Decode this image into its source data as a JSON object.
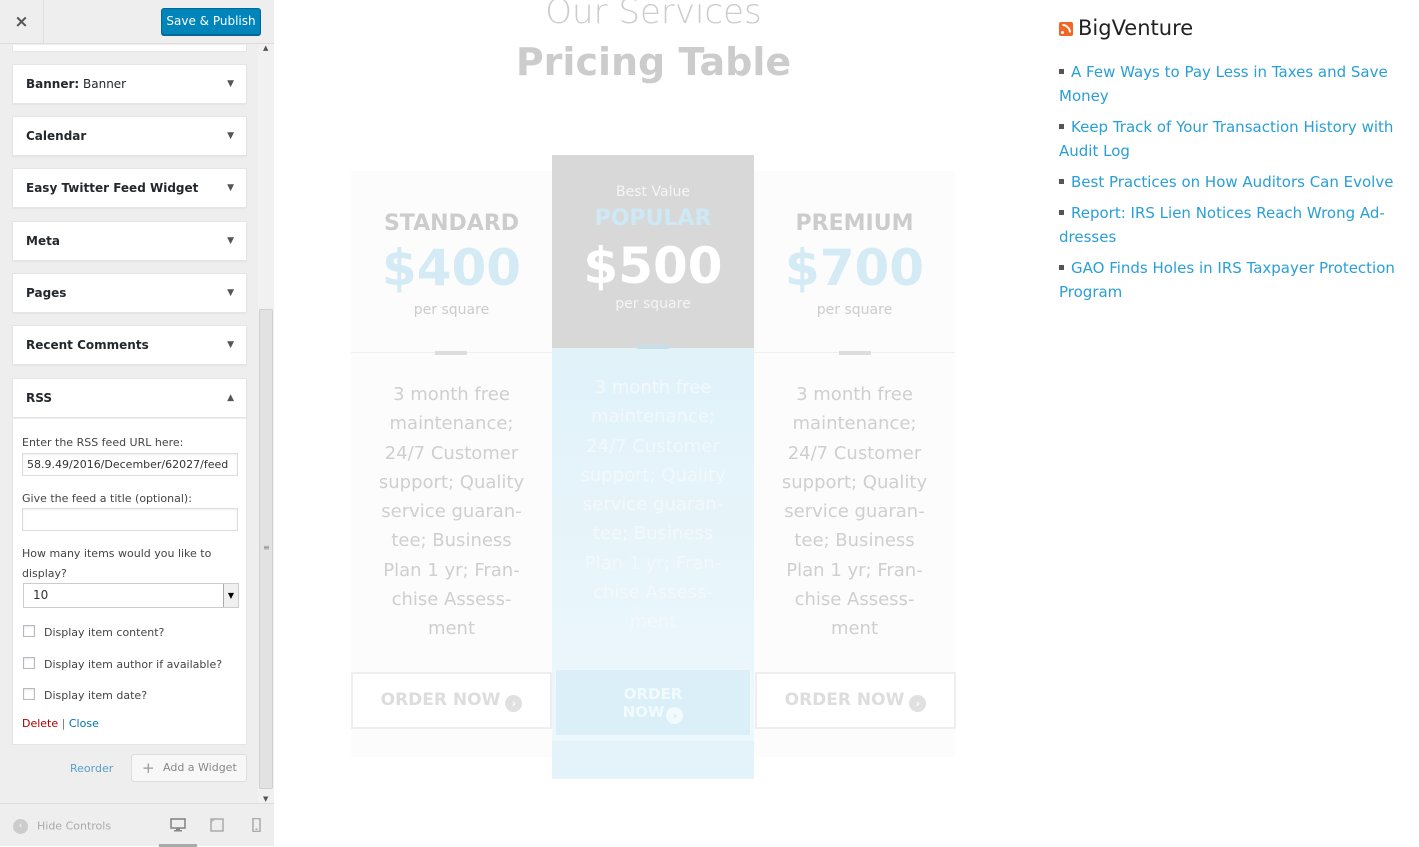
{
  "customizer": {
    "close_icon": "×",
    "publish_label": "Save & Publish",
    "widgets": [
      {
        "title": "Banner:",
        "subtitle": " Banner",
        "arrow": "▼"
      },
      {
        "title": "Calendar",
        "subtitle": "",
        "arrow": "▼"
      },
      {
        "title": "Easy Twitter Feed Widget",
        "subtitle": "",
        "arrow": "▼"
      },
      {
        "title": "Meta",
        "subtitle": "",
        "arrow": "▼"
      },
      {
        "title": "Pages",
        "subtitle": "",
        "arrow": "▼"
      },
      {
        "title": "Recent Comments",
        "subtitle": "",
        "arrow": "▼"
      },
      {
        "title": "RSS",
        "subtitle": "",
        "arrow": "▲"
      }
    ],
    "rss_form": {
      "url_label": "Enter the RSS feed URL here:",
      "url_value": "58.9.49/2016/December/62027/feed",
      "title_label": "Give the feed a title (optional):",
      "title_value": "",
      "items_label_line1": "How many items would you like to",
      "items_label_line2": "display?",
      "items_value": "10",
      "show_content_label": "Display item content?",
      "show_author_label": "Display item author if available?",
      "show_date_label": "Display item date?",
      "delete_label": "Delete",
      "separator": "|",
      "close_label": "Close"
    },
    "reorder_label": "Reorder",
    "add_widget_label": "Add a Widget",
    "hide_controls_label": "Hide Controls",
    "icons": {
      "add": "+",
      "scroll_up": "▲",
      "scroll_down": "▼",
      "scroll_grip": "≡",
      "hide_controls": "‹"
    }
  },
  "preview": {
    "section_title": "Our Services",
    "section_subtitle": "Pricing Table",
    "plans": {
      "standard": {
        "name": "STANDARD",
        "price": "$400",
        "unit": "per square",
        "desc": [
          "3 month free",
          "maintenance;",
          "24/7 Customer",
          "support; Quality",
          "service guaran-",
          "tee; Business",
          "Plan 1 yr; Fran-",
          "chise Assess-",
          "ment"
        ],
        "button": "ORDER NOW"
      },
      "popular": {
        "badge": "Best Value",
        "name": "POPULAR",
        "price": "$500",
        "unit": "per square",
        "desc": [
          "3 month free",
          "maintenance;",
          "24/7 Customer",
          "support; Quality",
          "service guaran-",
          "tee; Business",
          "Plan 1 yr; Fran-",
          "chise Assess-",
          "ment"
        ],
        "button_line1": "ORDER",
        "button_line2": "NOW"
      },
      "premium": {
        "name": "PREMIUM",
        "price": "$700",
        "unit": "per square",
        "desc": [
          "3 month free",
          "maintenance;",
          "24/7 Customer",
          "support; Quality",
          "service guaran-",
          "tee; Business",
          "Plan 1 yr; Fran-",
          "chise Assess-",
          "ment"
        ],
        "button": "ORDER NOW"
      }
    },
    "arrow_glyph": "›",
    "rss_widget": {
      "title": "BigVenture",
      "items": [
        "A Few Ways to Pay Less in Taxes and Save Money",
        "Keep Track of Your Transaction History with Audit Log",
        "Best Practices on How Auditors Can Evolve",
        "Report: IRS Lien Notices Reach Wrong Ad-dresses",
        "GAO Finds Holes in IRS Taxpayer Protection Program"
      ]
    }
  },
  "colors": {
    "publish": "#0085ba",
    "link": "#2a9fd6",
    "delete": "#aa0000",
    "rss": "#f26522"
  }
}
